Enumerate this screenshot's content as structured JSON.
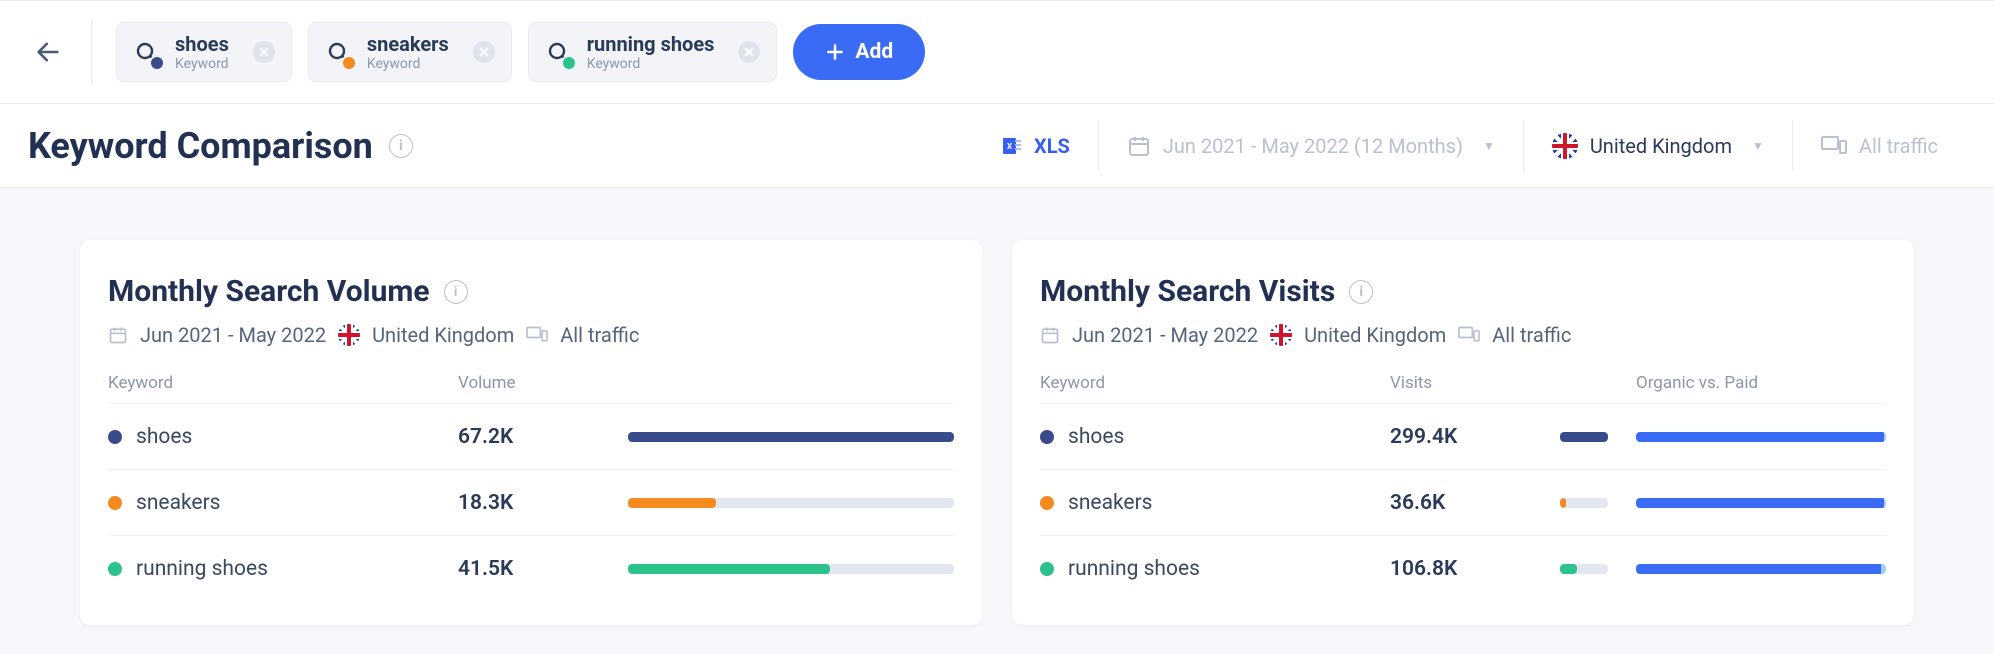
{
  "keywords": [
    {
      "name": "shoes",
      "sub": "Keyword",
      "color": "#3a4b8c"
    },
    {
      "name": "sneakers",
      "sub": "Keyword",
      "color": "#f58b1f"
    },
    {
      "name": "running shoes",
      "sub": "Keyword",
      "color": "#2bc28b"
    }
  ],
  "add_label": "Add",
  "page_title": "Keyword Comparison",
  "export_label": "XLS",
  "date_range": "Jun 2021 - May 2022 (12 Months)",
  "country": "United Kingdom",
  "traffic_filter": "All traffic",
  "card_date_range": "Jun 2021 - May 2022",
  "cards": {
    "volume": {
      "title": "Monthly Search Volume",
      "columns": {
        "kw": "Keyword",
        "val": "Volume"
      }
    },
    "visits": {
      "title": "Monthly Search Visits",
      "columns": {
        "kw": "Keyword",
        "val": "Visits",
        "ovp": "Organic vs. Paid"
      }
    }
  },
  "chart_data": [
    {
      "type": "bar",
      "title": "Monthly Search Volume",
      "categories": [
        "shoes",
        "sneakers",
        "running shoes"
      ],
      "values": [
        67200,
        18300,
        41500
      ],
      "value_labels": [
        "67.2K",
        "18.3K",
        "41.5K"
      ],
      "colors": [
        "#3a4b8c",
        "#f58b1f",
        "#2bc28b"
      ],
      "bar_pct": [
        100,
        27,
        62
      ]
    },
    {
      "type": "bar",
      "title": "Monthly Search Visits",
      "categories": [
        "shoes",
        "sneakers",
        "running shoes"
      ],
      "values": [
        299400,
        36600,
        106800
      ],
      "value_labels": [
        "299.4K",
        "36.6K",
        "106.8K"
      ],
      "colors": [
        "#3a4b8c",
        "#f58b1f",
        "#2bc28b"
      ],
      "bar_pct": [
        100,
        12,
        36
      ],
      "organic_vs_paid_pct": [
        {
          "organic": 99,
          "paid": 1
        },
        {
          "organic": 99,
          "paid": 1
        },
        {
          "organic": 98,
          "paid": 2
        }
      ]
    }
  ]
}
